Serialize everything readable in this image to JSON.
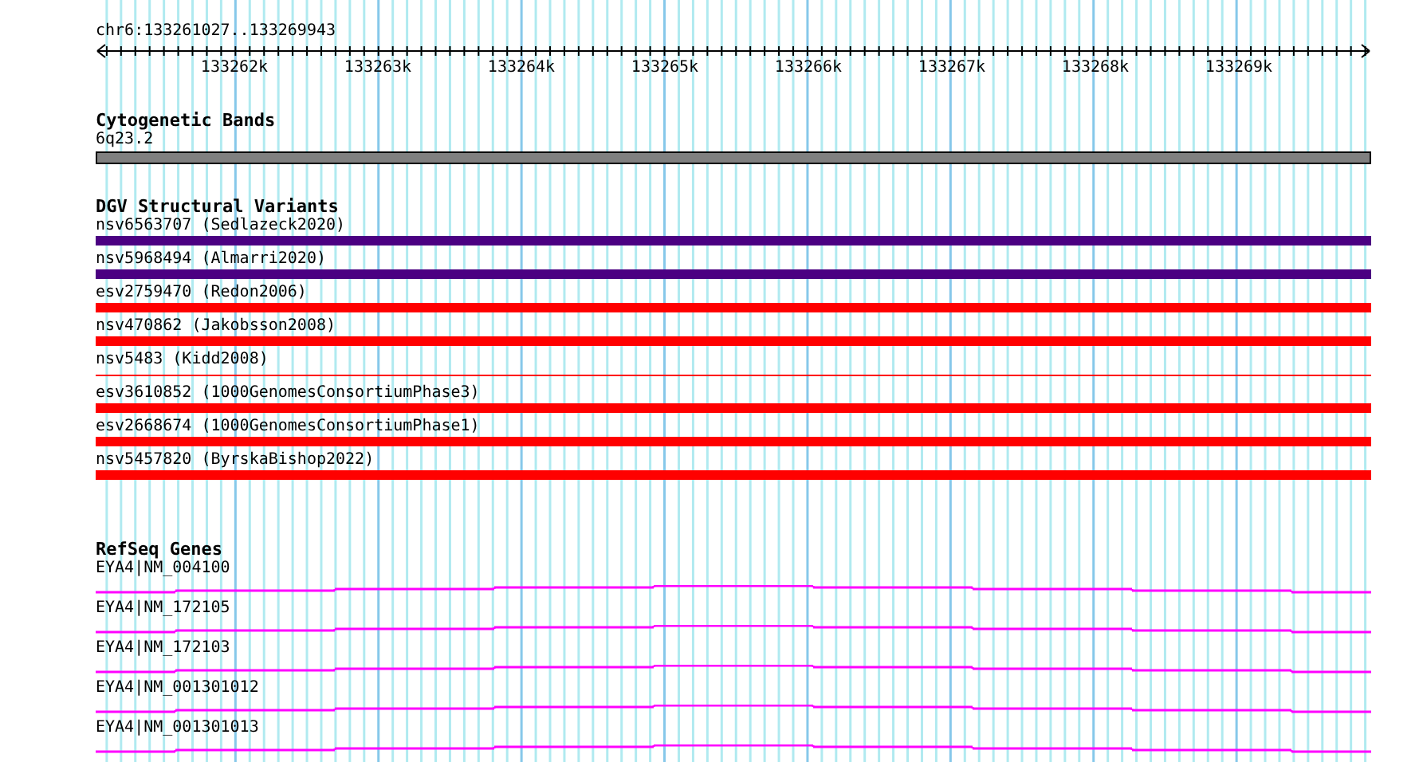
{
  "ruler": {
    "range": "chr6:133261027..133269943",
    "ticks": [
      "133262k",
      "133263k",
      "133264k",
      "133265k",
      "133266k",
      "133267k",
      "133268k",
      "133269k"
    ]
  },
  "cytogenetic_bands": {
    "title": "Cytogenetic Bands",
    "band": {
      "label": "6q23.2"
    }
  },
  "dgv_structural_variants": {
    "title": "DGV Structural Variants",
    "variants": [
      {
        "label": "nsv6563707 (Sedlazeck2020)",
        "color": "#4b0082",
        "kind": "bar"
      },
      {
        "label": "nsv5968494 (Almarri2020)",
        "color": "#4b0082",
        "kind": "bar"
      },
      {
        "label": "esv2759470 (Redon2006)",
        "color": "#ff0000",
        "kind": "bar"
      },
      {
        "label": "nsv470862 (Jakobsson2008)",
        "color": "#ff0000",
        "kind": "bar"
      },
      {
        "label": "nsv5483 (Kidd2008)",
        "color": "#ff0000",
        "kind": "line"
      },
      {
        "label": "esv3610852 (1000GenomesConsortiumPhase3)",
        "color": "#ff0000",
        "kind": "bar"
      },
      {
        "label": "esv2668674 (1000GenomesConsortiumPhase1)",
        "color": "#ff0000",
        "kind": "bar"
      },
      {
        "label": "nsv5457820 (ByrskaBishop2022)",
        "color": "#ff0000",
        "kind": "bar"
      }
    ]
  },
  "refseq_genes": {
    "title": "RefSeq Genes",
    "genes": [
      {
        "label": "EYA4|NM_004100"
      },
      {
        "label": "EYA4|NM_172105"
      },
      {
        "label": "EYA4|NM_172103"
      },
      {
        "label": "EYA4|NM_001301012"
      },
      {
        "label": "EYA4|NM_001301013"
      }
    ]
  }
}
